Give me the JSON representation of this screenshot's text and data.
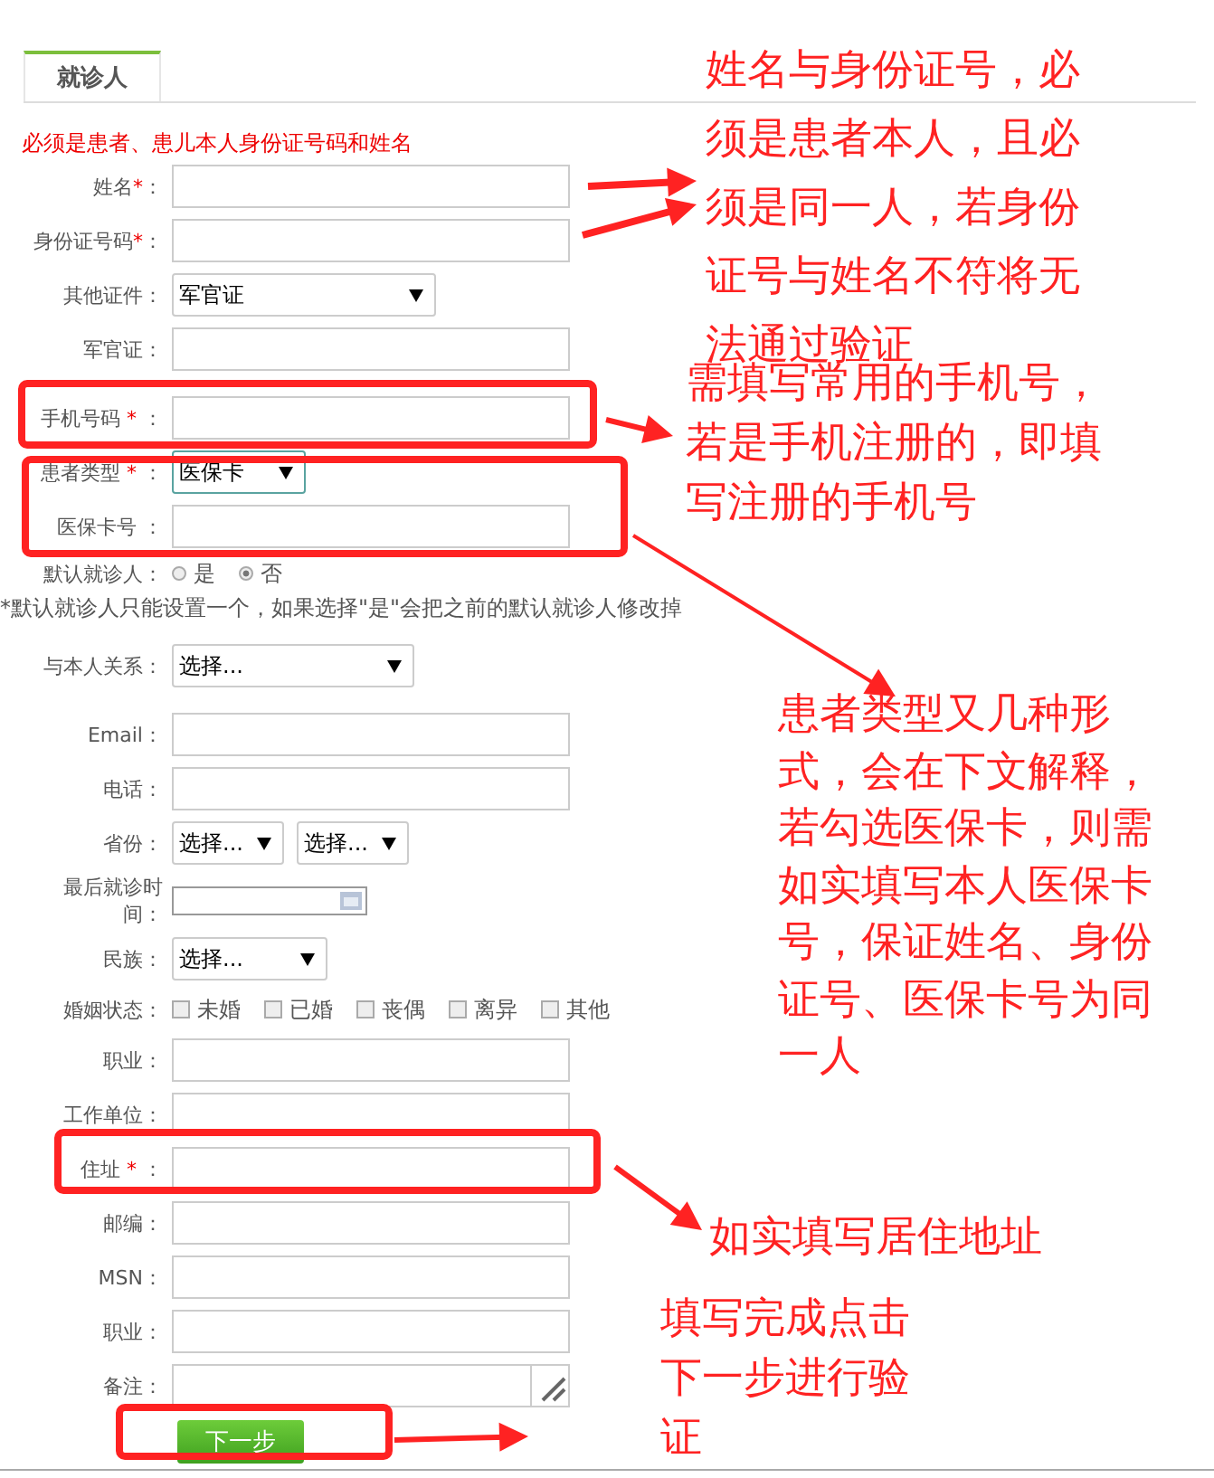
{
  "tab": {
    "label": "就诊人",
    "selected": true
  },
  "notice": "必须是患者、患儿本人身份证号码和姓名",
  "fields": [
    {
      "kind": "text",
      "label": "姓名",
      "asterisk": "*",
      "colon": "："
    },
    {
      "kind": "text",
      "label": "身份证号码",
      "asterisk": "*",
      "colon": "："
    },
    {
      "kind": "select",
      "label": "其他证件",
      "colon": "：",
      "value": "军官证",
      "focused": false
    },
    {
      "kind": "text",
      "label": "军官证",
      "colon": "："
    },
    {
      "kind": "text",
      "label": "手机号码",
      "asterisk": " *",
      "colon": " ："
    },
    {
      "kind": "select",
      "label": "患者类型",
      "asterisk": " *",
      "colon": " ：",
      "value": "医保卡",
      "focused": true
    },
    {
      "kind": "text",
      "label": "医保卡号",
      "colon": " ："
    },
    {
      "kind": "radio",
      "label": "默认就诊人",
      "colon": "：",
      "options": [
        {
          "label": "是",
          "selected": false
        },
        {
          "label": "否",
          "selected": true
        }
      ]
    },
    {
      "kind": "note",
      "text": "*默认就诊人只能设置一个，如果选择\"是\"会把之前的默认就诊人修改掉"
    },
    {
      "kind": "select",
      "label": "与本人关系",
      "colon": "：",
      "value": "选择...",
      "focused": false
    },
    {
      "kind": "text",
      "label": "Email",
      "colon": "："
    },
    {
      "kind": "text",
      "label": "电话",
      "colon": "："
    },
    {
      "kind": "selects",
      "label": "省份",
      "colon": "：",
      "values": [
        "选择...",
        "选择..."
      ]
    },
    {
      "kind": "date",
      "label": "最后就诊时间",
      "colon": "："
    },
    {
      "kind": "select",
      "label": "民族",
      "colon": "：",
      "value": "选择...",
      "focused": false
    },
    {
      "kind": "checkbox",
      "label": "婚姻状态",
      "colon": "：",
      "options": [
        {
          "label": "未婚",
          "checked": false
        },
        {
          "label": "已婚",
          "checked": false
        },
        {
          "label": "丧偶",
          "checked": false
        },
        {
          "label": "离异",
          "checked": false
        },
        {
          "label": "其他",
          "checked": false
        }
      ]
    },
    {
      "kind": "text",
      "label": "职业",
      "colon": "："
    },
    {
      "kind": "text",
      "label": "工作单位",
      "colon": "："
    },
    {
      "kind": "text",
      "label": "住址",
      "asterisk": " *",
      "colon": " ："
    },
    {
      "kind": "text",
      "label": "邮编",
      "colon": "："
    },
    {
      "kind": "text",
      "label": "MSN",
      "colon": "："
    },
    {
      "kind": "text",
      "label": "职业",
      "colon": "："
    },
    {
      "kind": "textarea",
      "label": "备注",
      "colon": "："
    }
  ],
  "next_button": "下一步",
  "annotations": [
    "姓名与身份证号，必须是患者本人，且必须是同一人，若身份证号与姓名不符将无法通过验证",
    "需填写常用的手机号，若是手机注册的，即填写注册的手机号",
    "患者类型又几种形式，会在下文解释，若勾选医保卡，则需如实填写本人医保卡号，保证姓名、身份证号、医保卡号为同一人",
    "如实填写居住地址",
    "填写完成点击下一步进行验证"
  ]
}
